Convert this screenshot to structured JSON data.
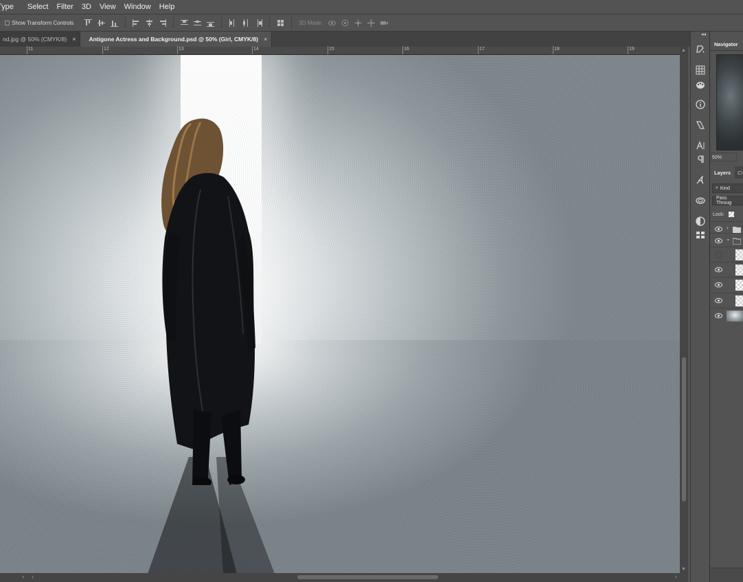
{
  "menu": [
    "Type",
    "Select",
    "Filter",
    "3D",
    "View",
    "Window",
    "Help"
  ],
  "options_bar": {
    "show_transform_label": "Show Transform Controls",
    "show_transform_checked": false,
    "mode_label": "3D Mode:"
  },
  "tabs": [
    {
      "label": "nd.jpg @ 50% (CMYK/8)",
      "active": false
    },
    {
      "label": "Antigone Actress and Background.psd @ 50% (Girl, CMYK/8)",
      "active": true
    }
  ],
  "tab_close": "×",
  "ruler": {
    "ticks": [
      "11",
      "12",
      "13",
      "14",
      "15",
      "16",
      "17",
      "18",
      "19"
    ]
  },
  "panels": {
    "navigator_title": "Navigator",
    "zoom": "50%",
    "layers_title": "Layers",
    "channels_tab_short": "Cl",
    "filter_kind": "Kind",
    "blend_mode": "Pass Throug",
    "lock_label": "Lock:"
  },
  "layers": [
    {
      "visible": true,
      "type": "group-collapsed"
    },
    {
      "visible": true,
      "type": "group-expanded"
    },
    {
      "visible": false,
      "type": "pixel"
    },
    {
      "visible": true,
      "type": "pixel"
    },
    {
      "visible": true,
      "type": "pixel"
    },
    {
      "visible": true,
      "type": "pixel"
    },
    {
      "visible": true,
      "type": "image"
    }
  ],
  "colors": {
    "ui_bg": "#535353",
    "tab_active": "#535353",
    "tab_inactive": "#3d3d3d"
  }
}
